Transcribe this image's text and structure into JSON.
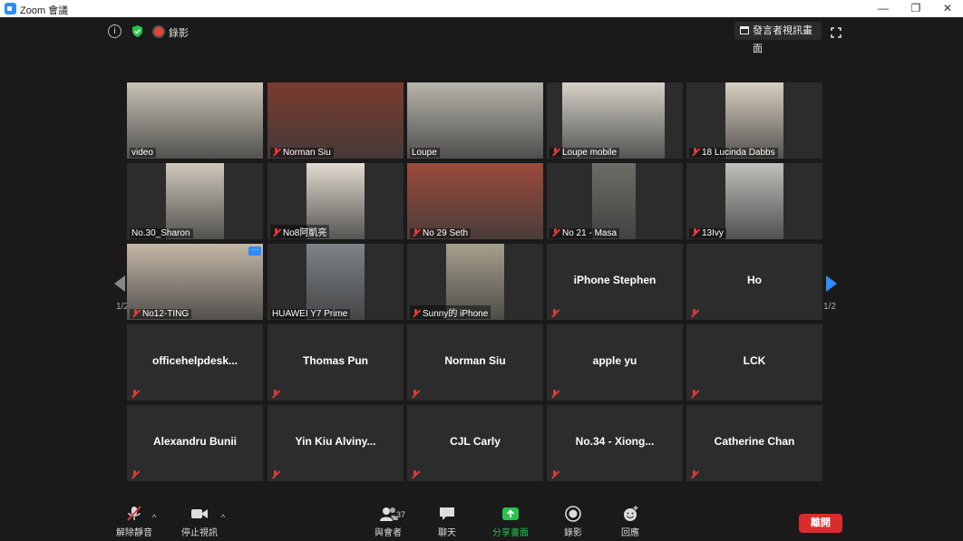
{
  "window": {
    "title": "Zoom 會議",
    "controls": [
      "—",
      "❐",
      "✕"
    ]
  },
  "topbar": {
    "recording_label": "錄影",
    "view_button": "發言者視訊畫面",
    "icons": [
      "info-icon",
      "shield-check-icon",
      "recording-icon",
      "fullscreen-icon"
    ]
  },
  "pager": {
    "left": "1/2",
    "right": "1/2"
  },
  "participants": [
    {
      "name": "video",
      "muted": false,
      "active": true,
      "video": true
    },
    {
      "name": "Norman Siu",
      "muted": true,
      "video": true
    },
    {
      "name": "Loupe",
      "muted": false,
      "video": true
    },
    {
      "name": "Loupe mobile",
      "muted": true,
      "video": true
    },
    {
      "name": "18 Lucinda Dabbs",
      "muted": true,
      "video": true
    },
    {
      "name": "No.30_Sharon",
      "muted": false,
      "video": true
    },
    {
      "name": "No8阿凱亮",
      "muted": true,
      "video": true
    },
    {
      "name": "No 29 Seth",
      "muted": true,
      "video": true
    },
    {
      "name": "No 21 - Masa",
      "muted": true,
      "video": true
    },
    {
      "name": "13Ivy",
      "muted": true,
      "video": true
    },
    {
      "name": "No12-TING",
      "muted": true,
      "video": true,
      "more": "···"
    },
    {
      "name": "HUAWEI Y7 Prime",
      "muted": false,
      "video": true
    },
    {
      "name": "Sunny的 iPhone",
      "muted": true,
      "video": true
    },
    {
      "name": "iPhone Stephen",
      "muted": true,
      "video": false
    },
    {
      "name": "Ho",
      "muted": true,
      "video": false
    },
    {
      "name": "officehelpdesk...",
      "muted": true,
      "video": false
    },
    {
      "name": "Thomas Pun",
      "muted": true,
      "video": false
    },
    {
      "name": "Norman Siu",
      "muted": true,
      "video": false
    },
    {
      "name": "apple yu",
      "muted": true,
      "video": false
    },
    {
      "name": "LCK",
      "muted": true,
      "video": false
    },
    {
      "name": "Alexandru Bunii",
      "muted": true,
      "video": false
    },
    {
      "name": "Yin Kiu Alviny...",
      "muted": true,
      "video": false
    },
    {
      "name": "CJL Carly",
      "muted": true,
      "video": false
    },
    {
      "name": "No.34 - Xiong...",
      "muted": true,
      "video": false
    },
    {
      "name": "Catherine Chan",
      "muted": true,
      "video": false
    }
  ],
  "toolbar": {
    "unmute": "解除靜音",
    "stop_video": "停止視訊",
    "participants": "與會者",
    "participants_count": "37",
    "chat": "聊天",
    "share": "分享畫面",
    "record": "錄影",
    "reactions": "回應",
    "end": "離開"
  },
  "colors": {
    "accent": "#2d8cff",
    "active_border": "#c8e35a",
    "end": "#d92d2d",
    "share_green": "#27c24c"
  }
}
